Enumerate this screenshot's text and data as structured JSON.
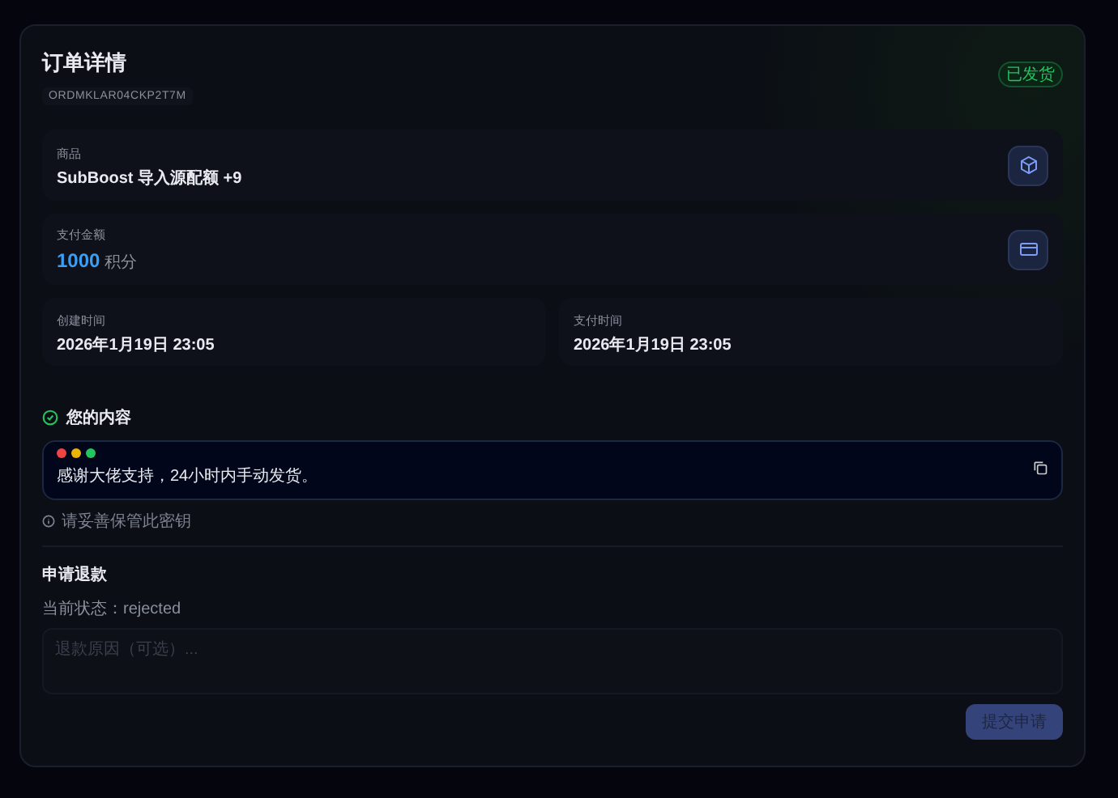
{
  "order": {
    "title": "订单详情",
    "order_id": "ORDMKLAR04CKP2T7M",
    "status_badge": "已发货"
  },
  "product": {
    "label": "商品",
    "value": "SubBoost 导入源配额 +9"
  },
  "payment": {
    "label": "支付金额",
    "amount": "1000",
    "unit": "积分"
  },
  "times": [
    {
      "label": "创建时间",
      "value": "2026年1月19日 23:05"
    },
    {
      "label": "支付时间",
      "value": "2026年1月19日 23:05"
    }
  ],
  "content": {
    "title": "您的内容",
    "text": "感谢大佬支持，24小时内手动发货。",
    "hint": "请妥善保管此密钥"
  },
  "refund": {
    "title": "申请退款",
    "status": "当前状态：rejected",
    "placeholder": "退款原因（可选）...",
    "submit": {
      "label": "提交申请",
      "disabled": true
    }
  }
}
